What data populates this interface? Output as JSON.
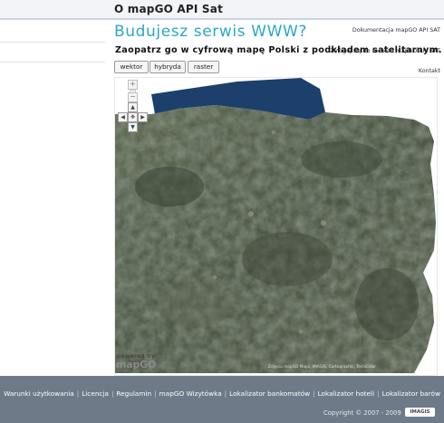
{
  "header": {
    "title": "O mapGO API Sat"
  },
  "sidebar": {
    "items": [
      {
        "label": "Dokumentacja mapGO API SAT"
      },
      {
        "label": "Zaloguj się do serwisu mapGO API SAT"
      },
      {
        "label": "Kontakt"
      }
    ]
  },
  "main": {
    "headline": "Budujesz serwis WWW?",
    "subheadline": "Zaopatrz go w cyfrową mapę Polski z podkładem satelitarnym.",
    "map_types": [
      "wektor",
      "hybryda",
      "raster"
    ]
  },
  "map": {
    "zoom_in": "+",
    "zoom_out": "−",
    "pan": {
      "up": "▲",
      "down": "▼",
      "left": "◀",
      "right": "▶",
      "center": "✥"
    },
    "powered_by": "powered by",
    "logo_text": "mapGO",
    "attribution": "Zdjęcia mapGO Maps, IMAGIS, Cartographic, TerraColor",
    "colors": {
      "sea": "#1c3f6b",
      "land": "#505b4c"
    }
  },
  "footer": {
    "links": [
      "Warunki użytkowania",
      "Licencja",
      "Regulamin",
      "mapGO Wizytówka",
      "Lokalizator bankomatów",
      "Lokalizator hoteli",
      "Lokalizator barów"
    ],
    "copyright": "Copyright © 2007 - 2009",
    "badge": "IMAGIS"
  }
}
